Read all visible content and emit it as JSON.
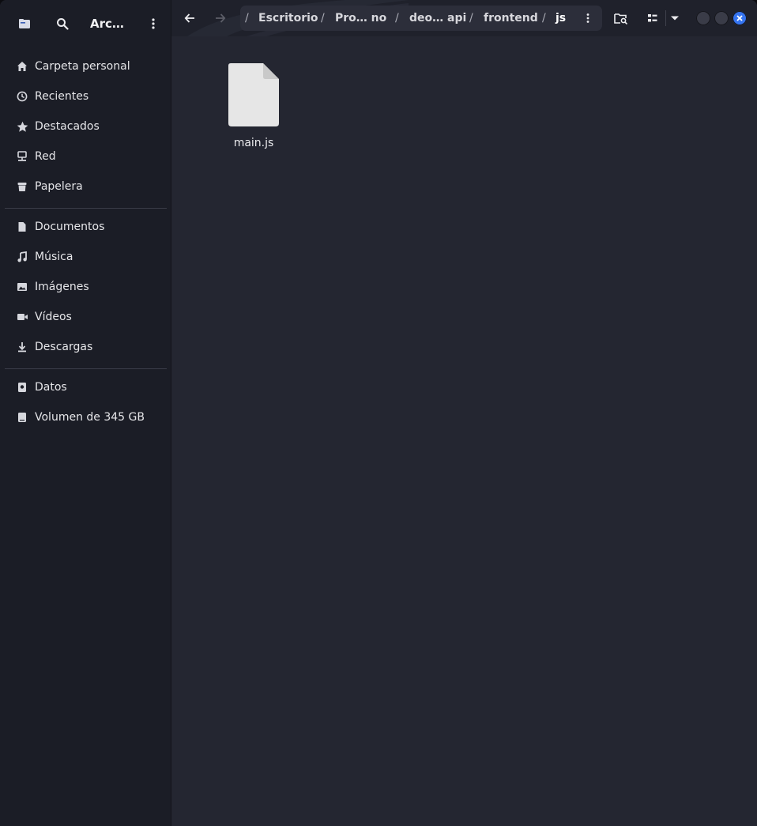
{
  "app": {
    "title": "Arc…"
  },
  "sidebar": {
    "places": [
      {
        "label": "Carpeta personal",
        "icon": "home-icon"
      },
      {
        "label": "Recientes",
        "icon": "clock-icon"
      },
      {
        "label": "Destacados",
        "icon": "star-icon"
      },
      {
        "label": "Red",
        "icon": "network-icon"
      },
      {
        "label": "Papelera",
        "icon": "trash-icon"
      }
    ],
    "bookmarks": [
      {
        "label": "Documentos",
        "icon": "document-icon"
      },
      {
        "label": "Música",
        "icon": "music-icon"
      },
      {
        "label": "Imágenes",
        "icon": "image-icon"
      },
      {
        "label": "Vídeos",
        "icon": "video-icon"
      },
      {
        "label": "Descargas",
        "icon": "download-icon"
      }
    ],
    "devices": [
      {
        "label": "Datos",
        "icon": "drive-icon"
      },
      {
        "label": "Volumen de 345 GB",
        "icon": "drive-icon"
      }
    ]
  },
  "pathbar": {
    "crumbs": [
      "Escritorio",
      "Pro…  no",
      "deo… api",
      "frontend",
      "js"
    ]
  },
  "files": [
    {
      "name": "main.js",
      "icon": "text-file-icon"
    }
  ],
  "colors": {
    "accent": "#3574f0",
    "sidebar_bg": "#1b1d26",
    "content_bg": "#242631"
  }
}
